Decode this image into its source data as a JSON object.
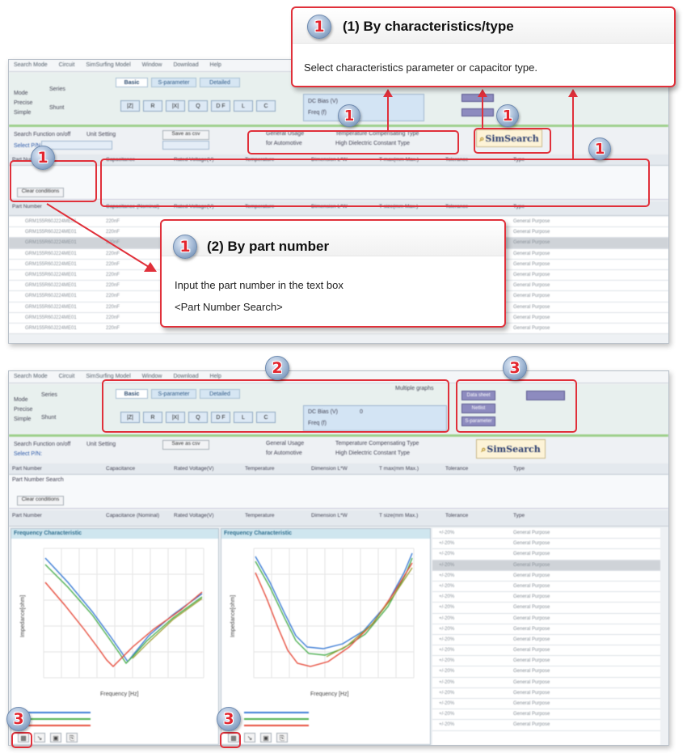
{
  "callouts": {
    "top": {
      "number": "1",
      "title": "(1) By characteristics/type",
      "description": "Select characteristics parameter or capacitor type."
    },
    "middle": {
      "number": "1",
      "title": "(2) By part number",
      "line1": "Input the part number in the text box",
      "line2": "<Part Number Search>"
    }
  },
  "badges": {
    "one": "1",
    "two": "2",
    "three": "3"
  },
  "app": {
    "menu": [
      "Search Mode",
      "Circuit",
      "SimSurfing Model",
      "Window",
      "Download",
      "Help"
    ],
    "tabs": [
      "Basic",
      "S-parameter",
      "Detailed"
    ],
    "param_buttons": [
      "|Z|",
      "R",
      "|X|",
      "Q",
      "D F",
      "L",
      "C"
    ],
    "mode_label": "Mode",
    "mode_options": [
      "Series",
      "Shunt"
    ],
    "precise_options": [
      "Precise",
      "Simple"
    ],
    "dc_bias_label": "DC Bias (V)",
    "dc_bias_value": "0",
    "freq_label": "Freq (f)",
    "side_buttons": [
      "Data sheet",
      "Netlist",
      "S-parameter"
    ],
    "search_function_label": "Search Function on/off",
    "unit_setting_label": "Unit Setting",
    "save_button": "Save as csv",
    "select_pn_label": "Select P/N:",
    "type_filters": [
      "General Usage",
      "Temperature Compensating Type",
      "for Automotive",
      "High Dielectric Constant Type"
    ],
    "simsearch_label": "SimSearch",
    "clear_button": "Clear conditions",
    "part_number_search_label": "Part Number Search",
    "filter_headers": [
      "Part Number",
      "Capacitance",
      "Rated Voltage(V)",
      "Temperature",
      "Dimension L*W",
      "T max(mm Max.)",
      "Tolerance",
      "Type"
    ],
    "grid_headers": [
      "Part Number",
      "Capacitance (Nominal)",
      "Rated Voltage(V)",
      "Temperature",
      "Dimension L*W",
      "T size(mm Max.)",
      "Tolerance",
      "Type"
    ],
    "row_part_number": "GRM155R60J224ME01",
    "row_capacitance": "220nF",
    "row_type": "General Purpose",
    "row_tolerance": "+/-20%",
    "chart_title": "Frequency Characteristic",
    "x_axis_label": "Frequency [Hz]",
    "y_axis_label_left": "Impedance[ohm]",
    "y_axis_label_right": "Impedance[ohm]",
    "multiple_graphs": "Multiple graphs"
  },
  "colors": {
    "accent_red": "#e0303a",
    "series_blue": "#3a7bd5",
    "series_green": "#4caf50",
    "series_red": "#e74c3c",
    "series_olive": "#9a9a2a"
  }
}
